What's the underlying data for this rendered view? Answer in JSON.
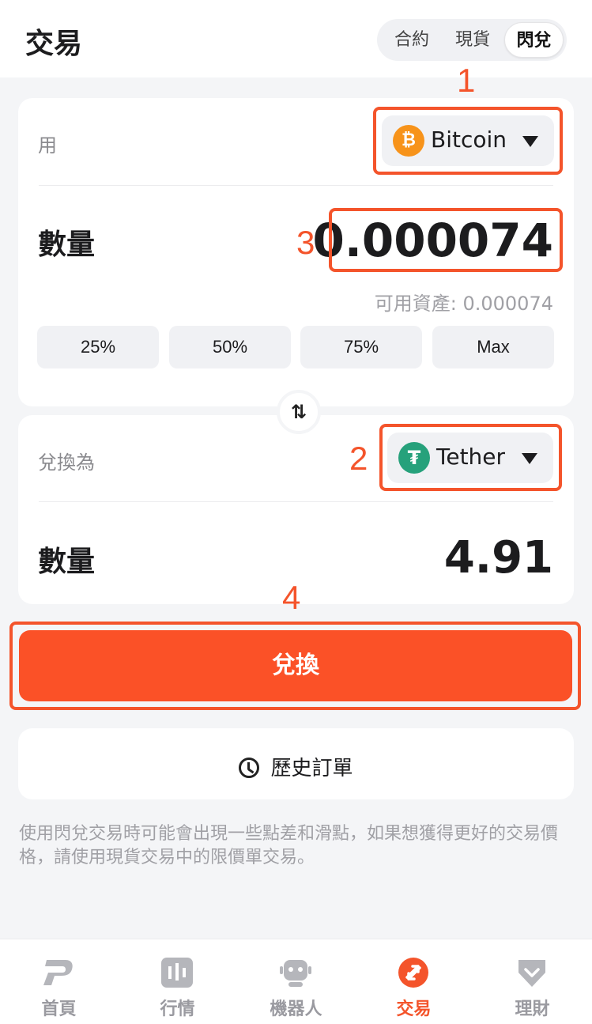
{
  "header": {
    "title": "交易",
    "segments": [
      "合約",
      "現貨",
      "閃兌"
    ],
    "active_segment": "閃兌"
  },
  "from": {
    "label": "用",
    "coin": "Bitcoin",
    "coin_icon": "bitcoin-icon",
    "qty_label": "數量",
    "amount": "0.000074",
    "available": "可用資產: 0.000074",
    "percent_buttons": [
      "25%",
      "50%",
      "75%",
      "Max"
    ]
  },
  "swap_icon": "swap-arrows-icon",
  "to": {
    "label": "兌換為",
    "coin": "Tether",
    "coin_icon": "tether-icon",
    "qty_label": "數量",
    "amount": "4.91"
  },
  "annotations": [
    "1",
    "2",
    "3",
    "4"
  ],
  "convert_button": "兌換",
  "history_button": "歷史訂單",
  "notice": "使用閃兌交易時可能會出現一些點差和滑點，如果想獲得更好的交易價格，請使用現貨交易中的限價單交易。",
  "tabbar": {
    "items": [
      {
        "label": "首頁",
        "icon": "home-p-icon"
      },
      {
        "label": "行情",
        "icon": "chart-icon"
      },
      {
        "label": "機器人",
        "icon": "robot-icon"
      },
      {
        "label": "交易",
        "icon": "trade-icon"
      },
      {
        "label": "理財",
        "icon": "diamond-icon"
      }
    ],
    "active": "交易"
  },
  "colors": {
    "accent": "#fb5127",
    "annotation": "#f4542b",
    "bitcoin": "#f7931a",
    "tether": "#26a17b"
  }
}
